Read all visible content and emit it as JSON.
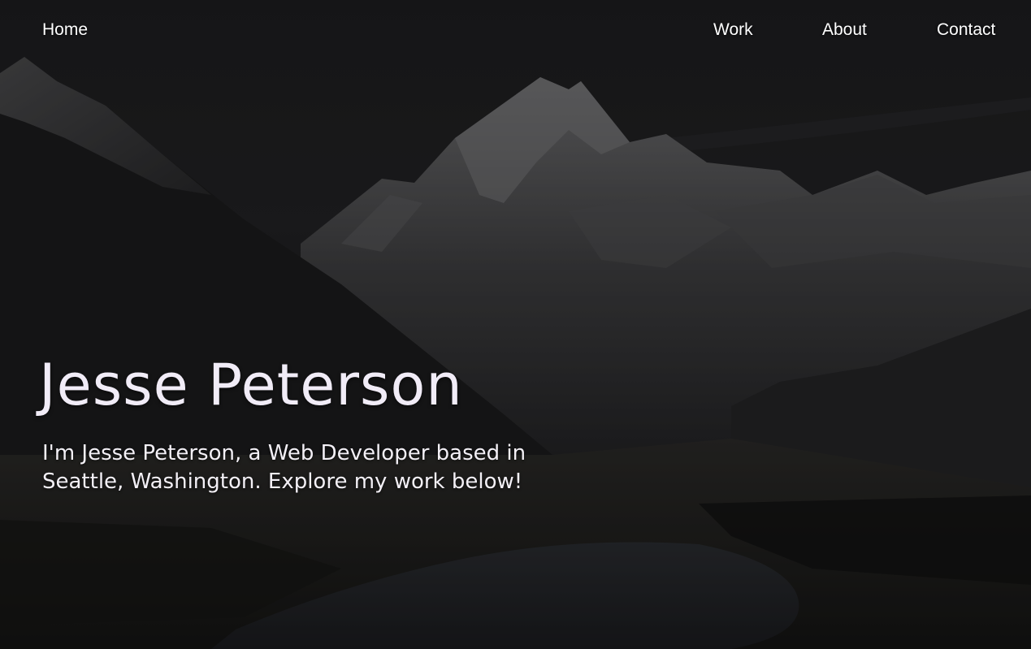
{
  "nav": {
    "home_label": "Home",
    "work_label": "Work",
    "about_label": "About",
    "contact_label": "Contact"
  },
  "hero": {
    "title": "Jesse Peterson",
    "subtitle": "I'm Jesse Peterson, a Web Developer based in Seattle, Washington. Explore my work below!"
  },
  "colors": {
    "overlay": "#000000",
    "text_primary": "#ffffff",
    "title_text": "#f1ecf7"
  }
}
